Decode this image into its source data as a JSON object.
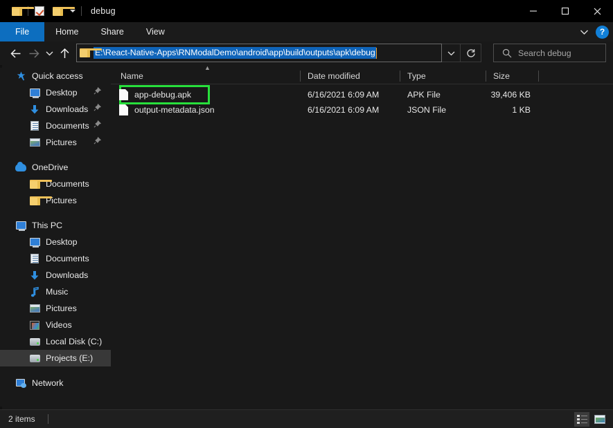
{
  "window": {
    "title": "debug",
    "quick_access_toolbar": [
      {
        "name": "folder-properties",
        "icon": "folder-icon"
      },
      {
        "name": "toggle-selection",
        "icon": "checkbox-icon"
      },
      {
        "name": "new-folder",
        "icon": "folder-icon"
      },
      {
        "name": "customize-toolbar",
        "icon": "chevron-down-icon"
      }
    ],
    "controls": {
      "minimize": "—",
      "maximize": "□",
      "close": "✕"
    }
  },
  "ribbon": {
    "tabs": [
      {
        "label": "File",
        "active": true
      },
      {
        "label": "Home",
        "active": false
      },
      {
        "label": "Share",
        "active": false
      },
      {
        "label": "View",
        "active": false
      }
    ],
    "collapse_icon": "chevron-down-icon",
    "help_label": "?"
  },
  "navbar": {
    "back_icon": "arrow-left-icon",
    "forward_icon": "arrow-right-icon",
    "recent_icon": "chevron-down-icon",
    "up_icon": "arrow-up-icon",
    "address_value": "E:\\React-Native-Apps\\RNModalDemo\\android\\app\\build\\outputs\\apk\\debug",
    "address_dropdown_icon": "chevron-down-icon",
    "refresh_icon": "refresh-icon",
    "search_placeholder": "Search debug",
    "search_icon": "search-icon"
  },
  "sidebar": {
    "groups": [
      {
        "name": "quick-access",
        "header": {
          "label": "Quick access",
          "icon": "star-pin-icon"
        },
        "items": [
          {
            "label": "Desktop",
            "icon": "monitor-icon",
            "pinned": true
          },
          {
            "label": "Downloads",
            "icon": "download-icon",
            "pinned": true
          },
          {
            "label": "Documents",
            "icon": "document-icon",
            "pinned": true
          },
          {
            "label": "Pictures",
            "icon": "picture-icon",
            "pinned": true
          }
        ]
      },
      {
        "name": "onedrive",
        "header": {
          "label": "OneDrive",
          "icon": "cloud-icon"
        },
        "items": [
          {
            "label": "Documents",
            "icon": "folder-icon",
            "pinned": false
          },
          {
            "label": "Pictures",
            "icon": "folder-icon",
            "pinned": false
          }
        ]
      },
      {
        "name": "this-pc",
        "header": {
          "label": "This PC",
          "icon": "monitor-icon"
        },
        "items": [
          {
            "label": "Desktop",
            "icon": "monitor-icon",
            "pinned": false,
            "selected": false
          },
          {
            "label": "Documents",
            "icon": "document-icon",
            "pinned": false,
            "selected": false
          },
          {
            "label": "Downloads",
            "icon": "download-icon",
            "pinned": false,
            "selected": false
          },
          {
            "label": "Music",
            "icon": "music-icon",
            "pinned": false,
            "selected": false
          },
          {
            "label": "Pictures",
            "icon": "picture-icon",
            "pinned": false,
            "selected": false
          },
          {
            "label": "Videos",
            "icon": "video-icon",
            "pinned": false,
            "selected": false
          },
          {
            "label": "Local Disk (C:)",
            "icon": "disk-icon",
            "pinned": false,
            "selected": false
          },
          {
            "label": "Projects (E:)",
            "icon": "disk-icon",
            "pinned": false,
            "selected": true
          }
        ]
      },
      {
        "name": "network",
        "header": {
          "label": "Network",
          "icon": "network-icon"
        },
        "items": []
      }
    ]
  },
  "file_list": {
    "columns": [
      {
        "key": "name",
        "label": "Name",
        "sorted": "ascending"
      },
      {
        "key": "date",
        "label": "Date modified"
      },
      {
        "key": "type",
        "label": "Type"
      },
      {
        "key": "size",
        "label": "Size"
      }
    ],
    "sort_indicator_icon": "chevron-up-icon",
    "rows": [
      {
        "name": "app-debug.apk",
        "date": "6/16/2021 6:09 AM",
        "type": "APK File",
        "size": "39,406 KB",
        "icon": "generic-file-icon",
        "highlighted": true
      },
      {
        "name": "output-metadata.json",
        "date": "6/16/2021 6:09 AM",
        "type": "JSON File",
        "size": "1 KB",
        "icon": "generic-file-icon",
        "highlighted": false
      }
    ]
  },
  "statusbar": {
    "item_count": "2 items",
    "view_details_icon": "details-view-icon",
    "view_large_icons_icon": "large-icons-view-icon"
  },
  "colors": {
    "accent": "#0d6ebf",
    "selection": "#0f64b9",
    "highlight_box": "#28e03c",
    "window_bg": "#191919",
    "titlebar_bg": "#000000",
    "text": "#e6e6e6"
  }
}
